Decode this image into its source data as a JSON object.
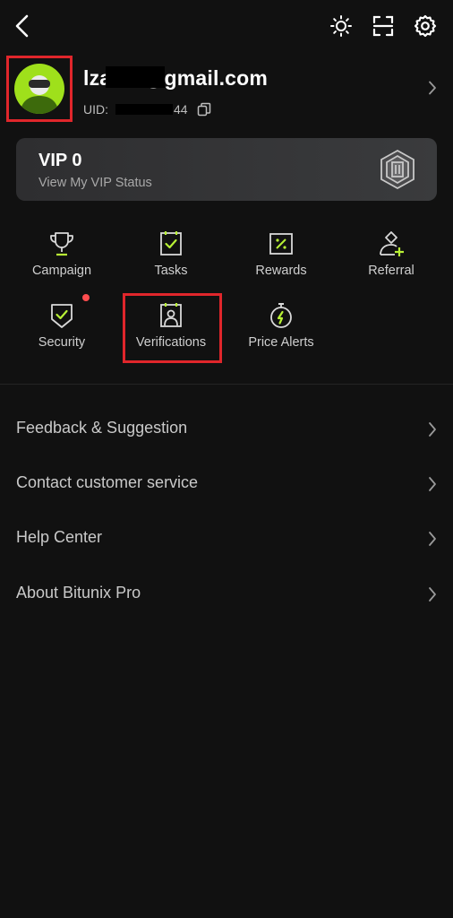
{
  "profile": {
    "email": "lza****@gmail.com",
    "uid_label": "UID:",
    "uid_suffix": "44"
  },
  "vip": {
    "title": "VIP 0",
    "subtitle": "View My VIP Status"
  },
  "grid": {
    "campaign": "Campaign",
    "tasks": "Tasks",
    "rewards": "Rewards",
    "referral": "Referral",
    "security": "Security",
    "verifications": "Verifications",
    "price_alerts": "Price Alerts"
  },
  "list": {
    "feedback": "Feedback & Suggestion",
    "contact": "Contact customer service",
    "help": "Help Center",
    "about": "About Bitunix Pro"
  },
  "colors": {
    "accent": "#b8f135",
    "highlight": "#e0262b",
    "badge": "#ff4d4f",
    "background": "#111111"
  }
}
